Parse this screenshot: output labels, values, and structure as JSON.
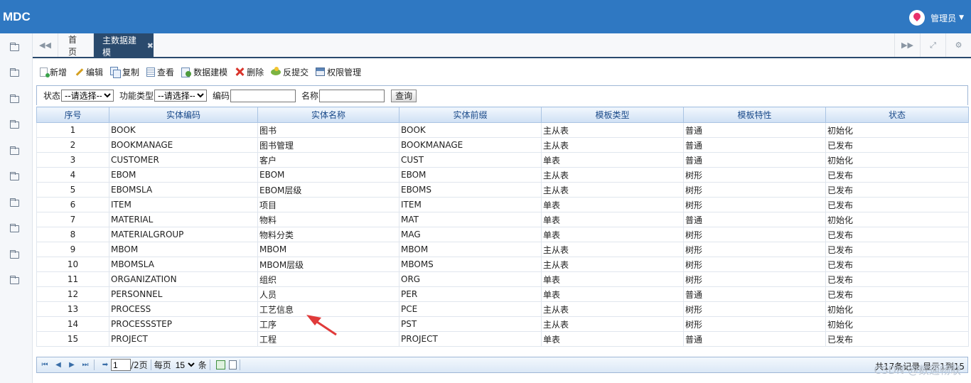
{
  "app": {
    "logo": "MDC",
    "user": "管理员"
  },
  "tabs": {
    "home": "首页",
    "active": "主数据建模"
  },
  "toolbar": [
    {
      "label": "新增",
      "icon": "add-icon"
    },
    {
      "label": "编辑",
      "icon": "edit-icon"
    },
    {
      "label": "复制",
      "icon": "copy-icon"
    },
    {
      "label": "查看",
      "icon": "view-icon"
    },
    {
      "label": "数据建模",
      "icon": "data-model-icon"
    },
    {
      "label": "删除",
      "icon": "delete-icon"
    },
    {
      "label": "反提交",
      "icon": "unsubmit-icon"
    },
    {
      "label": "权限管理",
      "icon": "permission-icon"
    }
  ],
  "search": {
    "status_label": "状态",
    "status_value": "--请选择--",
    "type_label": "功能类型",
    "type_value": "--请选择--",
    "code_label": "编码",
    "name_label": "名称",
    "query_label": "查询"
  },
  "table": {
    "columns": [
      "序号",
      "实体编码",
      "实体名称",
      "实体前缀",
      "模板类型",
      "模板特性",
      "状态"
    ],
    "rows": [
      [
        "1",
        "BOOK",
        "图书",
        "BOOK",
        "主从表",
        "普通",
        "初始化"
      ],
      [
        "2",
        "BOOKMANAGE",
        "图书管理",
        "BOOKMANAGE",
        "主从表",
        "普通",
        "已发布"
      ],
      [
        "3",
        "CUSTOMER",
        "客户",
        "CUST",
        "单表",
        "普通",
        "初始化"
      ],
      [
        "4",
        "EBOM",
        "EBOM",
        "EBOM",
        "主从表",
        "树形",
        "已发布"
      ],
      [
        "5",
        "EBOMSLA",
        "EBOM层级",
        "EBOMS",
        "主从表",
        "树形",
        "已发布"
      ],
      [
        "6",
        "ITEM",
        "项目",
        "ITEM",
        "单表",
        "树形",
        "已发布"
      ],
      [
        "7",
        "MATERIAL",
        "物料",
        "MAT",
        "单表",
        "普通",
        "初始化"
      ],
      [
        "8",
        "MATERIALGROUP",
        "物料分类",
        "MAG",
        "单表",
        "树形",
        "已发布"
      ],
      [
        "9",
        "MBOM",
        "MBOM",
        "MBOM",
        "主从表",
        "树形",
        "已发布"
      ],
      [
        "10",
        "MBOMSLA",
        "MBOM层级",
        "MBOMS",
        "主从表",
        "树形",
        "已发布"
      ],
      [
        "11",
        "ORGANIZATION",
        "组织",
        "ORG",
        "单表",
        "树形",
        "已发布"
      ],
      [
        "12",
        "PERSONNEL",
        "人员",
        "PER",
        "单表",
        "普通",
        "已发布"
      ],
      [
        "13",
        "PROCESS",
        "工艺信息",
        "PCE",
        "主从表",
        "树形",
        "初始化"
      ],
      [
        "14",
        "PROCESSSTEP",
        "工序",
        "PST",
        "主从表",
        "树形",
        "初始化"
      ],
      [
        "15",
        "PROJECT",
        "工程",
        "PROJECT",
        "单表",
        "普通",
        "已发布"
      ]
    ]
  },
  "pager": {
    "current_page": "1",
    "total_pages": "/2页",
    "per_page_label": "每页",
    "per_page_value": "15",
    "per_page_unit": "条",
    "info": "共17条记录,显示1到15"
  },
  "watermark": "CSDN @数通畅联"
}
